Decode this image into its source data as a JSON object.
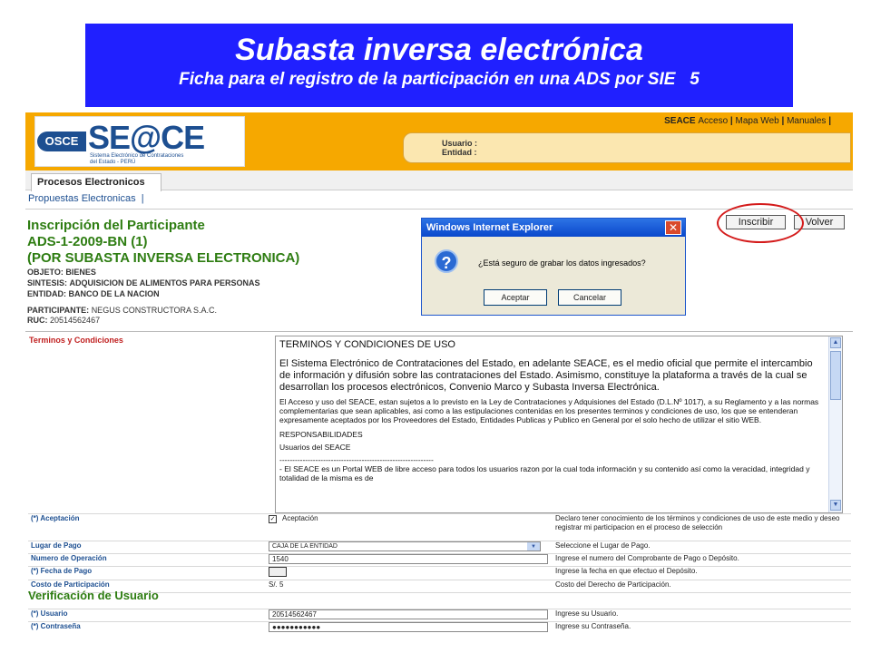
{
  "banner": {
    "title": "Subasta inversa electrónica",
    "subtitle": "Ficha para el registro de la participación en una ADS por SIE",
    "slide_number": "5"
  },
  "header": {
    "logo_badge": "OSCE",
    "logo_text": "SE@CE",
    "logo_sub_1": "Sistema Electrónico de Contrataciones",
    "logo_sub_2": "del Estado - PERÚ",
    "links": {
      "seace": "SEACE",
      "acceso": "Acceso",
      "mapa": "Mapa Web",
      "manuales": "Manuales"
    },
    "user_label": "Usuario :",
    "entity_label": "Entidad :"
  },
  "tabs": {
    "main": "Procesos Electronicos",
    "sub": "Propuestas Electronicas"
  },
  "process": {
    "heading": "Inscripción del Participante",
    "code": "ADS-1-2009-BN (1)",
    "type": "(POR SUBASTA INVERSA ELECTRONICA)",
    "objeto_label": "OBJETO:",
    "objeto": "BIENES",
    "sintesis_label": "SINTESIS:",
    "sintesis": "ADQUISICION DE ALIMENTOS PARA PERSONAS",
    "entidad_label": "ENTIDAD:",
    "entidad": "BANCO DE LA NACION",
    "participante_label": "PARTICIPANTE:",
    "participante": "NEGUS CONSTRUCTORA S.A.C.",
    "ruc_label": "RUC:",
    "ruc": "20514562467"
  },
  "actions": {
    "inscribir": "Inscribir",
    "volver": "Volver"
  },
  "dialog": {
    "title": "Windows Internet Explorer",
    "message": "¿Está seguro de grabar los datos ingresados?",
    "ok": "Aceptar",
    "cancel": "Cancelar"
  },
  "terms": {
    "label": "Terminos y Condiciones",
    "heading": "TERMINOS Y CONDICIONES DE USO",
    "p1": "El Sistema Electrónico de Contrataciones del Estado, en adelante SEACE, es el medio oficial que permite el intercambio de información y difusión sobre las contrataciones del Estado. Asimismo, constituye la plataforma a través de la cual se desarrollan los procesos electrónicos, Convenio Marco y Subasta Inversa Electrónica.",
    "p2": "El Acceso y uso del SEACE, estan sujetos a lo previsto en la Ley de Contrataciones y Adquisiones del Estado (D.L.Nº 1017), a su Reglamento y a las normas complementarias que sean aplicables, asi como a las estipulaciones contenidas en los presentes terminos y condiciones de uso, los que se entenderan expresamente aceptados por los Proveedores del Estado, Entidades Publicas y Publico en General por el solo hecho de utilizar el sitio WEB.",
    "resp": "RESPONSABILIDADES",
    "users": "Usuarios del SEACE",
    "dash": "------------------------------------------------------------",
    "bullet": "- El SEACE es un Portal WEB de libre acceso para todos los usuarios razon por la cual toda información y su contenido así como la veracidad, integridad y totalidad de la misma es de"
  },
  "form": {
    "aceptacion_label": "(*) Aceptación",
    "aceptacion_check": "Aceptación",
    "aceptacion_help": "Declaro tener conocimiento de los términos y condiciones de uso de este medio y deseo registrar mi participacion en el proceso de selección",
    "lugar_label": "Lugar de Pago",
    "lugar_value": "CAJA DE LA ENTIDAD",
    "lugar_help": "Seleccione el Lugar de Pago.",
    "operacion_label": "Numero de Operación",
    "operacion_value": "1540",
    "operacion_help": "Ingrese el numero del Comprobante de Pago o Depósito.",
    "fecha_label": "(*) Fecha de Pago",
    "fecha_help": "Ingrese la fecha en que efectuo el Depósito.",
    "costo_label": "Costo de Participación",
    "costo_value": "S/. 5",
    "costo_help": "Costo del Derecho de Participación.",
    "verif_heading": "Verificación de Usuario",
    "usuario_label": "(*) Usuario",
    "usuario_value": "20514562467",
    "usuario_help": "Ingrese su Usuario.",
    "pass_label": "(*) Contraseña",
    "pass_value": "●●●●●●●●●●●",
    "pass_help": "Ingrese su Contraseña."
  }
}
